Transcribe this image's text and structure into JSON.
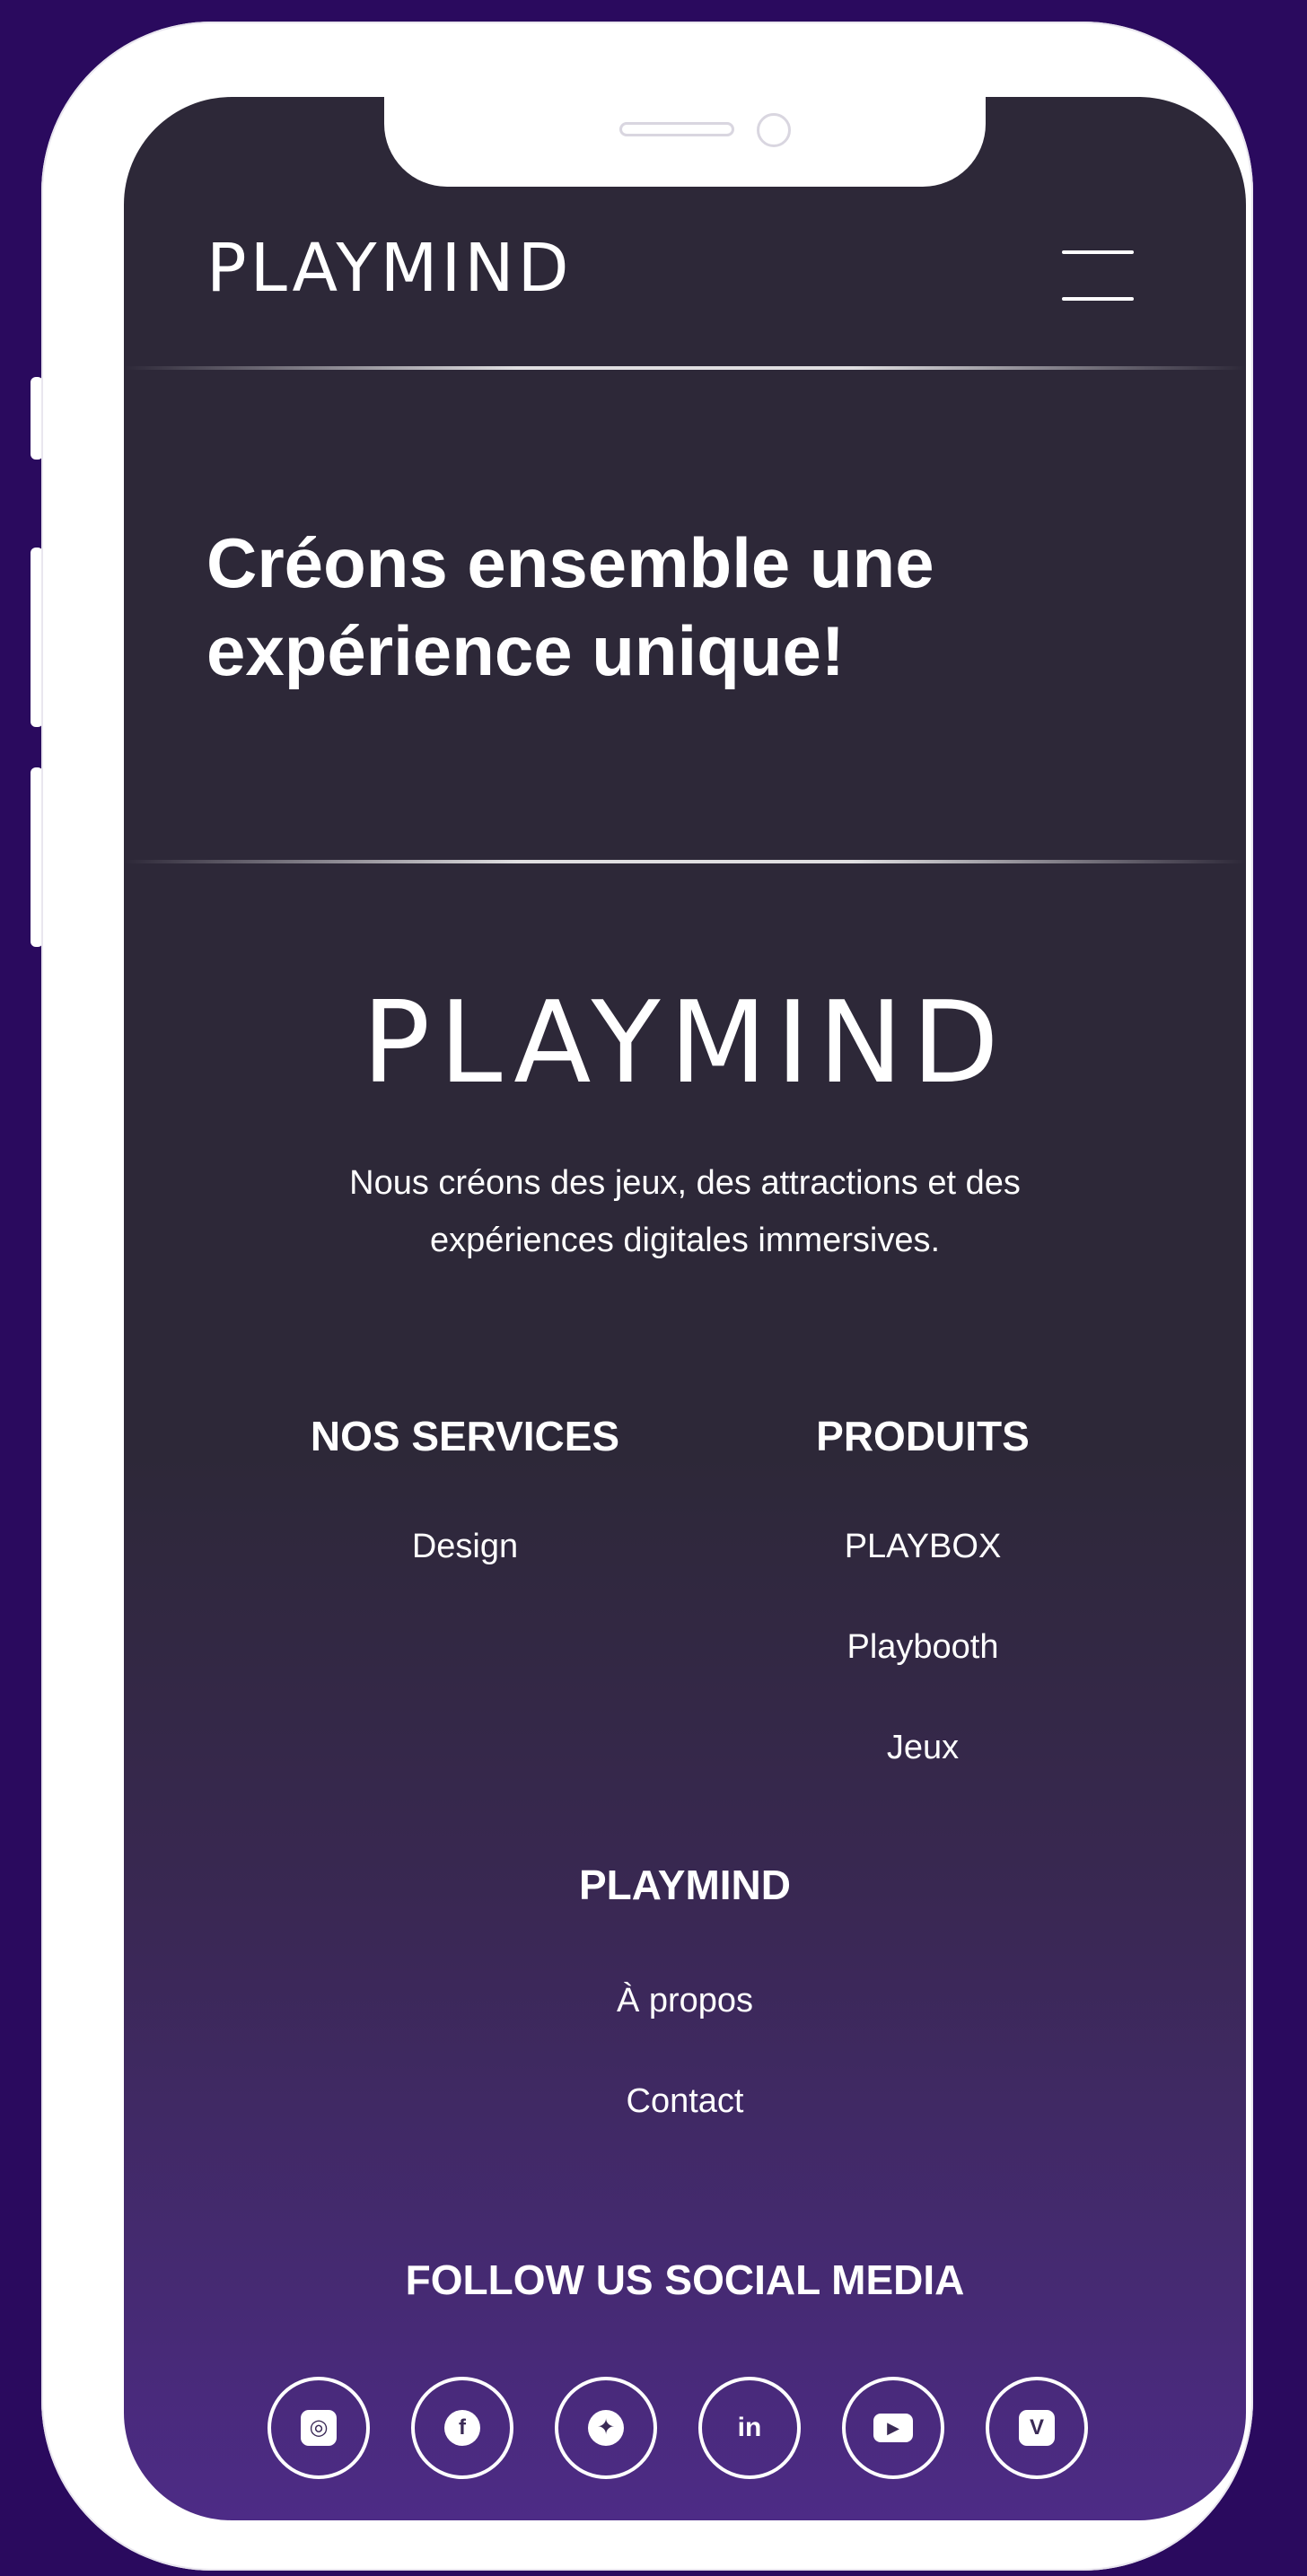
{
  "header": {
    "logo_text": "PLAYMIND"
  },
  "hero": {
    "headline_line1": "Créons ensemble une",
    "headline_line2": "expérience unique!"
  },
  "footer": {
    "logo_text": "PLAYMIND",
    "tagline_line1": "Nous créons des jeux, des attractions et des",
    "tagline_line2": "expériences digitales immersives.",
    "services": {
      "heading": "NOS SERVICES",
      "items": [
        "Design"
      ]
    },
    "products": {
      "heading": "PRODUITS",
      "items": [
        "PLAYBOX",
        "Playbooth",
        "Jeux"
      ]
    },
    "company": {
      "heading": "PLAYMIND",
      "items": [
        "À propos",
        "Contact"
      ]
    },
    "social": {
      "heading": "FOLLOW US SOCIAL MEDIA",
      "icons": [
        {
          "name": "instagram-icon",
          "glyph": "◎"
        },
        {
          "name": "facebook-icon",
          "glyph": "f"
        },
        {
          "name": "twitter-icon",
          "glyph": "✦"
        },
        {
          "name": "linkedin-icon",
          "glyph": "in"
        },
        {
          "name": "youtube-icon",
          "glyph": "▶"
        },
        {
          "name": "vimeo-icon",
          "glyph": "V"
        }
      ]
    }
  },
  "colors": {
    "background": "#2a0a5e",
    "screen_top": "#2d2838",
    "screen_bottom": "#4d2b86",
    "text": "#ffffff",
    "frame": "#ffffff"
  }
}
